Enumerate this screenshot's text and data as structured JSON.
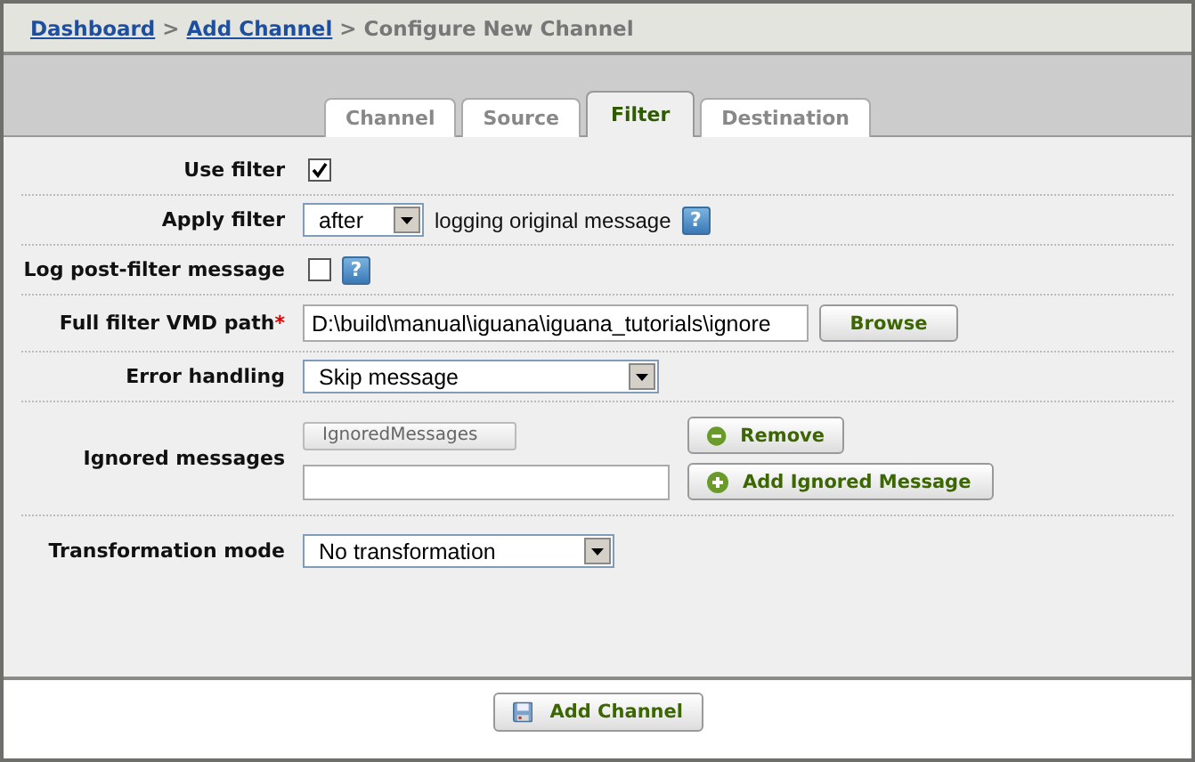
{
  "breadcrumb": [
    {
      "label": "Dashboard",
      "kind": "link"
    },
    {
      "label": ">",
      "kind": "separator"
    },
    {
      "label": "Add Channel",
      "kind": "link"
    },
    {
      "label": ">",
      "kind": "separator"
    },
    {
      "label": "Configure New Channel",
      "kind": "current"
    }
  ],
  "tabs": [
    {
      "label": "Channel",
      "selected": false
    },
    {
      "label": "Source",
      "selected": false
    },
    {
      "label": "Filter",
      "selected": true
    },
    {
      "label": "Destination",
      "selected": false
    }
  ],
  "rows": [
    {
      "kind": "checkbox",
      "label": "Use filter",
      "checked": true
    },
    {
      "kind": "select",
      "label": "Apply filter",
      "value": "after",
      "suffix": "logging original message",
      "help": "?"
    },
    {
      "kind": "checkbox",
      "label": "Log post-filter message",
      "checked": false,
      "help": "?"
    },
    {
      "kind": "path",
      "label": "Full filter VMD path",
      "required_mark": "*",
      "value": "D:\\build\\manual\\iguana\\iguana_tutorials\\ignore",
      "button": "Browse"
    },
    {
      "kind": "select",
      "label": "Error handling",
      "value": "Skip message"
    },
    {
      "kind": "list",
      "label": "Ignored messages",
      "items": [
        "IgnoredMessages"
      ],
      "remove_button": "Remove",
      "add_button": "Add Ignored Message"
    },
    {
      "kind": "select",
      "label": "Transformation mode",
      "value": "No transformation"
    }
  ],
  "footer": {
    "button": "Add Channel"
  }
}
